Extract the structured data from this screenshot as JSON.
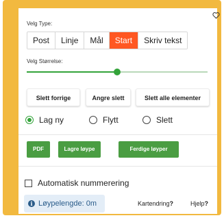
{
  "close_icon": "heart-outline-icon",
  "type_section": {
    "label": "Velg Type:",
    "options": [
      "Post",
      "Linje",
      "Mål",
      "Start",
      "Skriv tekst"
    ],
    "active": "Start",
    "active_color": "#ff5722"
  },
  "size_section": {
    "label": "Velg Størrelse:",
    "value": 0.5
  },
  "actions": {
    "delete_previous": "Slett forrige",
    "undo_delete": "Angre slett",
    "delete_all": "Slett alle elementer"
  },
  "mode": {
    "options": [
      "Lag ny",
      "Flytt",
      "Slett"
    ],
    "selected": "Lag ny"
  },
  "export": {
    "pdf": "PDF",
    "save_course": "Lagre løype",
    "finished_courses": "Ferdige løyper",
    "color": "#4a9d42"
  },
  "auto_numbering": {
    "label": "Automatisk nummerering",
    "checked": false
  },
  "footer": {
    "course_length": "Løypelengde: 0m",
    "map_change_label": "Kartendring",
    "help_label": "Hjelp",
    "question_mark": "?"
  },
  "frame_color": "#f2b93f"
}
